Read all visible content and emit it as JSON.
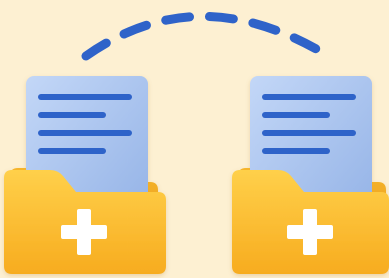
{
  "illustration": {
    "background_color": "#fdf0d2",
    "folders": [
      {
        "id": "left",
        "icon": "folder-add-icon",
        "document_lines": 4
      },
      {
        "id": "right",
        "icon": "folder-add-icon",
        "document_lines": 4
      }
    ],
    "transfer_arc": {
      "icon": "dashed-arc-icon",
      "color": "#2f63c9"
    },
    "colors": {
      "document": "#a9c4ef",
      "document_line": "#2f63c9",
      "folder_back": "#f1a81e",
      "folder_front": "#ffc43a",
      "plus": "#ffffff"
    }
  }
}
